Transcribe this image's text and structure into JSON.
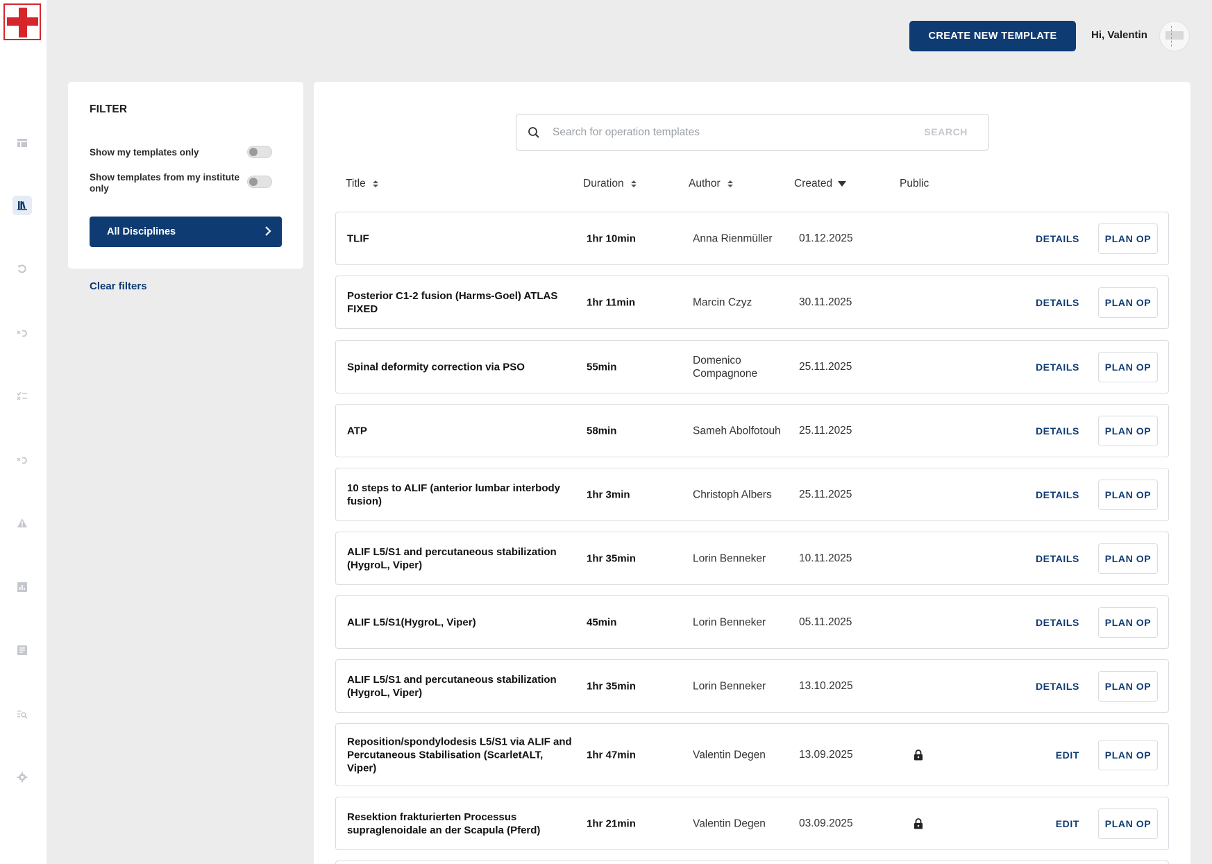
{
  "header": {
    "create_button": "CREATE NEW TEMPLATE",
    "greeting": "Hi, Valentin"
  },
  "sidebar": {
    "items": [
      {
        "icon": "dashboard-icon"
      },
      {
        "icon": "library-icon",
        "active": true
      },
      {
        "icon": "undo-icon"
      },
      {
        "icon": "history-icon"
      },
      {
        "icon": "checklist-icon"
      },
      {
        "icon": "history-alt-icon"
      },
      {
        "icon": "warning-icon"
      },
      {
        "icon": "chart-icon"
      },
      {
        "icon": "report-icon"
      },
      {
        "icon": "search-list-icon"
      },
      {
        "icon": "gear-icon"
      }
    ]
  },
  "filter": {
    "title": "FILTER",
    "toggle_my_templates": "Show my templates only",
    "toggle_institute": "Show templates from my institute only",
    "disciplines_button": "All Disciplines",
    "clear_filters": "Clear filters"
  },
  "search": {
    "placeholder": "Search for operation templates",
    "button": "SEARCH"
  },
  "table": {
    "columns": {
      "title": "Title",
      "duration": "Duration",
      "author": "Author",
      "created": "Created",
      "public": "Public"
    },
    "rows": [
      {
        "title": "TLIF",
        "duration": "1hr 10min",
        "author": "Anna Rienmüller",
        "created": "01.12.2025",
        "locked": false,
        "action": "DETAILS",
        "plan": "PLAN OP"
      },
      {
        "title": "Posterior C1-2 fusion (Harms-Goel) ATLAS FIXED",
        "duration": "1hr 11min",
        "author": "Marcin Czyz",
        "created": "30.11.2025",
        "locked": false,
        "action": "DETAILS",
        "plan": "PLAN OP"
      },
      {
        "title": "Spinal deformity correction via PSO",
        "duration": "55min",
        "author": "Domenico Compagnone",
        "created": "25.11.2025",
        "locked": false,
        "action": "DETAILS",
        "plan": "PLAN OP"
      },
      {
        "title": "ATP",
        "duration": "58min",
        "author": "Sameh Abolfotouh",
        "created": "25.11.2025",
        "locked": false,
        "action": "DETAILS",
        "plan": "PLAN OP"
      },
      {
        "title": "10 steps to ALIF (anterior lumbar interbody fusion)",
        "duration": "1hr 3min",
        "author": "Christoph Albers",
        "created": "25.11.2025",
        "locked": false,
        "action": "DETAILS",
        "plan": "PLAN OP"
      },
      {
        "title": "ALIF L5/S1 and percutaneous stabilization (HygroL, Viper)",
        "duration": "1hr 35min",
        "author": "Lorin Benneker",
        "created": "10.11.2025",
        "locked": false,
        "action": "DETAILS",
        "plan": "PLAN OP"
      },
      {
        "title": "ALIF L5/S1(HygroL, Viper)",
        "duration": "45min",
        "author": "Lorin Benneker",
        "created": "05.11.2025",
        "locked": false,
        "action": "DETAILS",
        "plan": "PLAN OP"
      },
      {
        "title": "ALIF L5/S1 and percutaneous stabilization (HygroL, Viper)",
        "duration": "1hr 35min",
        "author": "Lorin Benneker",
        "created": "13.10.2025",
        "locked": false,
        "action": "DETAILS",
        "plan": "PLAN OP"
      },
      {
        "title": "Reposition/spondylodesis L5/S1 via ALIF and Percutaneous Stabilisation (ScarletALT, Viper)",
        "duration": "1hr 47min",
        "author": "Valentin Degen",
        "created": "13.09.2025",
        "locked": true,
        "action": "EDIT",
        "plan": "PLAN OP"
      },
      {
        "title": "Resektion frakturierten Processus supraglenoidale an der Scapula (Pferd)",
        "duration": "1hr 21min",
        "author": "Valentin Degen",
        "created": "03.09.2025",
        "locked": true,
        "action": "EDIT",
        "plan": "PLAN OP"
      }
    ]
  },
  "colors": {
    "primary": "#0f3b73",
    "brand_red": "#d7262b",
    "background": "#ececed"
  }
}
